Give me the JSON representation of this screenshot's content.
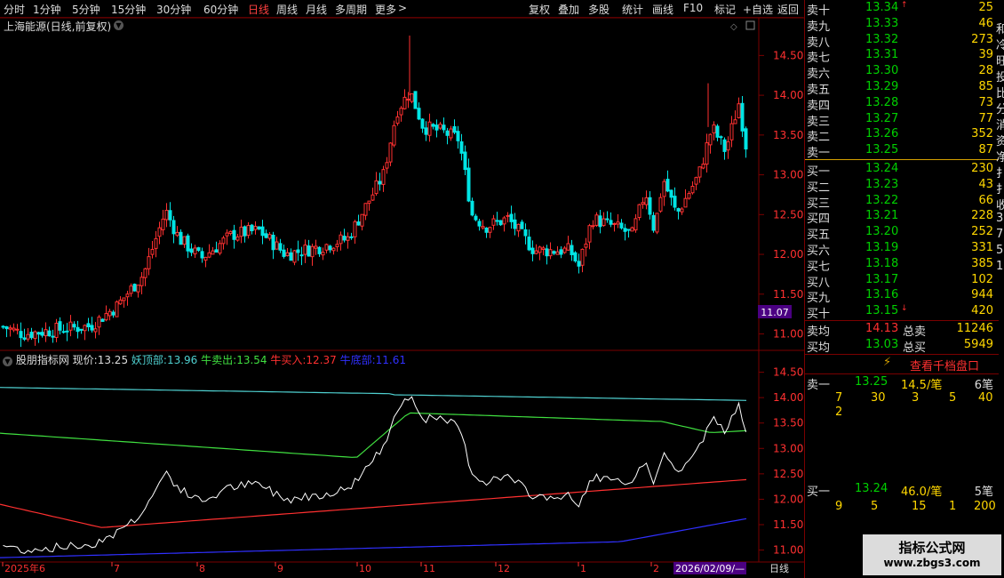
{
  "toolbar": {
    "periods": [
      "分时",
      "1分钟",
      "5分钟",
      "15分钟",
      "30分钟",
      "60分钟",
      "日线",
      "周线",
      "月线",
      "多周期",
      "更多"
    ],
    "active_period": "日线",
    "more_glyph": ">",
    "actions": [
      "复权",
      "叠加",
      "多股",
      "统计",
      "画线",
      "F10",
      "标记",
      "+自选",
      "返回"
    ]
  },
  "chart": {
    "title": "上海能源(日线,前复权)",
    "current_price_tag": "11.07",
    "price_axis": [
      "14.50",
      "14.00",
      "13.50",
      "13.00",
      "12.50",
      "12.00",
      "11.50",
      "11.00"
    ],
    "price_range": [
      10.95,
      14.75
    ]
  },
  "indicator": {
    "name": "股朋指标网",
    "now_label": "现价:",
    "now_value": "13.25",
    "lines": [
      {
        "label": "妖顶部:",
        "value": "13.96",
        "color": "#4fd0d0"
      },
      {
        "label": "牛卖出:",
        "value": "13.54",
        "color": "#40e040"
      },
      {
        "label": "牛买入:",
        "value": "12.37",
        "color": "#ff3030"
      },
      {
        "label": "牛底部:",
        "value": "11.61",
        "color": "#3030ff"
      }
    ],
    "axis": [
      "14.50",
      "14.00",
      "13.50",
      "13.00",
      "12.50",
      "12.00",
      "11.50",
      "11.00"
    ],
    "range": [
      10.8,
      14.65
    ]
  },
  "x_axis": {
    "labels": [
      "2025年6",
      "7",
      "8",
      "9",
      "10",
      "11",
      "12",
      "1",
      "2"
    ],
    "cursor_date": "2026/02/09/—",
    "period_tag": "日线"
  },
  "order_book": {
    "asks": [
      {
        "label": "卖十",
        "price": "13.34",
        "vol": "25",
        "mark": "↑"
      },
      {
        "label": "卖九",
        "price": "13.33",
        "vol": "46"
      },
      {
        "label": "卖八",
        "price": "13.32",
        "vol": "273"
      },
      {
        "label": "卖七",
        "price": "13.31",
        "vol": "39"
      },
      {
        "label": "卖六",
        "price": "13.30",
        "vol": "28"
      },
      {
        "label": "卖五",
        "price": "13.29",
        "vol": "85"
      },
      {
        "label": "卖四",
        "price": "13.28",
        "vol": "73"
      },
      {
        "label": "卖三",
        "price": "13.27",
        "vol": "77"
      },
      {
        "label": "卖二",
        "price": "13.26",
        "vol": "352"
      },
      {
        "label": "卖一",
        "price": "13.25",
        "vol": "87"
      }
    ],
    "bids": [
      {
        "label": "买一",
        "price": "13.24",
        "vol": "230"
      },
      {
        "label": "买二",
        "price": "13.23",
        "vol": "43"
      },
      {
        "label": "买三",
        "price": "13.22",
        "vol": "66"
      },
      {
        "label": "买四",
        "price": "13.21",
        "vol": "228"
      },
      {
        "label": "买五",
        "price": "13.20",
        "vol": "252"
      },
      {
        "label": "买六",
        "price": "13.19",
        "vol": "331"
      },
      {
        "label": "买七",
        "price": "13.18",
        "vol": "385"
      },
      {
        "label": "买八",
        "price": "13.17",
        "vol": "102"
      },
      {
        "label": "买九",
        "price": "13.16",
        "vol": "944"
      },
      {
        "label": "买十",
        "price": "13.15",
        "vol": "420",
        "mark": "↓"
      }
    ],
    "avg_sell_label": "卖均",
    "avg_sell": "14.13",
    "total_sell_label": "总卖",
    "total_sell": "11246",
    "avg_buy_label": "买均",
    "avg_buy": "13.03",
    "total_buy_label": "总买",
    "total_buy": "5949",
    "thousand_btn": "查看千档盘口",
    "q_sell": {
      "label": "卖一",
      "price": "13.25",
      "per": "14.5/笔",
      "count": "6笔",
      "row1": [
        "7",
        "30",
        "3",
        "5",
        "40"
      ],
      "row2": [
        "2"
      ]
    },
    "q_buy": {
      "label": "买一",
      "price": "13.24",
      "per": "46.0/笔",
      "count": "5笔",
      "row1": [
        "9",
        "5",
        "15",
        "1",
        "200"
      ]
    }
  },
  "side_edge": [
    "和",
    "冷",
    "旺",
    "投",
    "比",
    "分",
    "消",
    "资",
    "净",
    "扌",
    "扌",
    "收",
    "3",
    "7",
    "5",
    "1"
  ],
  "watermark": {
    "line1": "指标公式网",
    "line2": "www.zbgs3.com"
  },
  "colors": {
    "up": "#ff3030",
    "down": "#00e5e5",
    "label": "#ddd",
    "price": "#00d000",
    "vol": "#ffd700"
  }
}
